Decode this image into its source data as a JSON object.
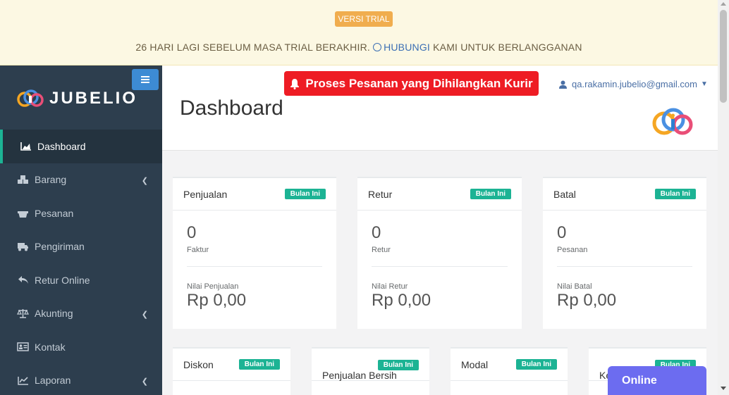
{
  "trial": {
    "badge": "VERSI TRIAL",
    "message_prefix": "26 HARI LAGI SEBELUM MASA TRIAL BERAKHIR. ",
    "link_text": "HUBUNGI",
    "message_suffix": " KAMI UNTUK BERLANGGANAN",
    "link_icon": "whatsapp-icon"
  },
  "sidebar": {
    "logo_text": "JUBELIO",
    "toggle_icon": "hamburger-icon",
    "items": [
      {
        "label": "Dashboard",
        "icon": "area-chart-icon",
        "active": true,
        "has_submenu": false
      },
      {
        "label": "Barang",
        "icon": "cubes-icon",
        "active": false,
        "has_submenu": true
      },
      {
        "label": "Pesanan",
        "icon": "basket-icon",
        "active": false,
        "has_submenu": false
      },
      {
        "label": "Pengiriman",
        "icon": "truck-icon",
        "active": false,
        "has_submenu": false
      },
      {
        "label": "Retur Online",
        "icon": "reply-icon",
        "active": false,
        "has_submenu": false
      },
      {
        "label": "Akunting",
        "icon": "balance-scale-icon",
        "active": false,
        "has_submenu": true
      },
      {
        "label": "Kontak",
        "icon": "address-card-icon",
        "active": false,
        "has_submenu": false
      },
      {
        "label": "Laporan",
        "icon": "line-chart-icon",
        "active": false,
        "has_submenu": true
      }
    ]
  },
  "header": {
    "alert_button": "Proses Pesanan yang Dihilangkan Kurir",
    "user_email": "qa.rakamin.jubelio@gmail.com",
    "page_title": "Dashboard"
  },
  "cards": [
    {
      "title": "Penjualan",
      "badge": "Bulan Ini",
      "count": "0",
      "count_label": "Faktur",
      "value_label": "Nilai Penjualan",
      "value": "Rp 0,00"
    },
    {
      "title": "Retur",
      "badge": "Bulan Ini",
      "count": "0",
      "count_label": "Retur",
      "value_label": "Nilai Retur",
      "value": "Rp 0,00"
    },
    {
      "title": "Batal",
      "badge": "Bulan Ini",
      "count": "0",
      "count_label": "Pesanan",
      "value_label": "Nilai Batal",
      "value": "Rp 0,00"
    }
  ],
  "cards_row2": [
    {
      "title": "Diskon",
      "badge": "Bulan Ini"
    },
    {
      "title": "Penjualan Bersih",
      "badge": "Bulan Ini"
    },
    {
      "title": "Modal",
      "badge": "Bulan Ini"
    },
    {
      "title": "Ke",
      "badge": "Bulan Ini"
    }
  ],
  "chat": {
    "label": "Online"
  },
  "colors": {
    "accent": "#1cb394",
    "sidebar": "#2d3e4e",
    "alert": "#ee1c24",
    "trial_badge": "#f0ad4e",
    "chat": "#6c6cf0"
  }
}
